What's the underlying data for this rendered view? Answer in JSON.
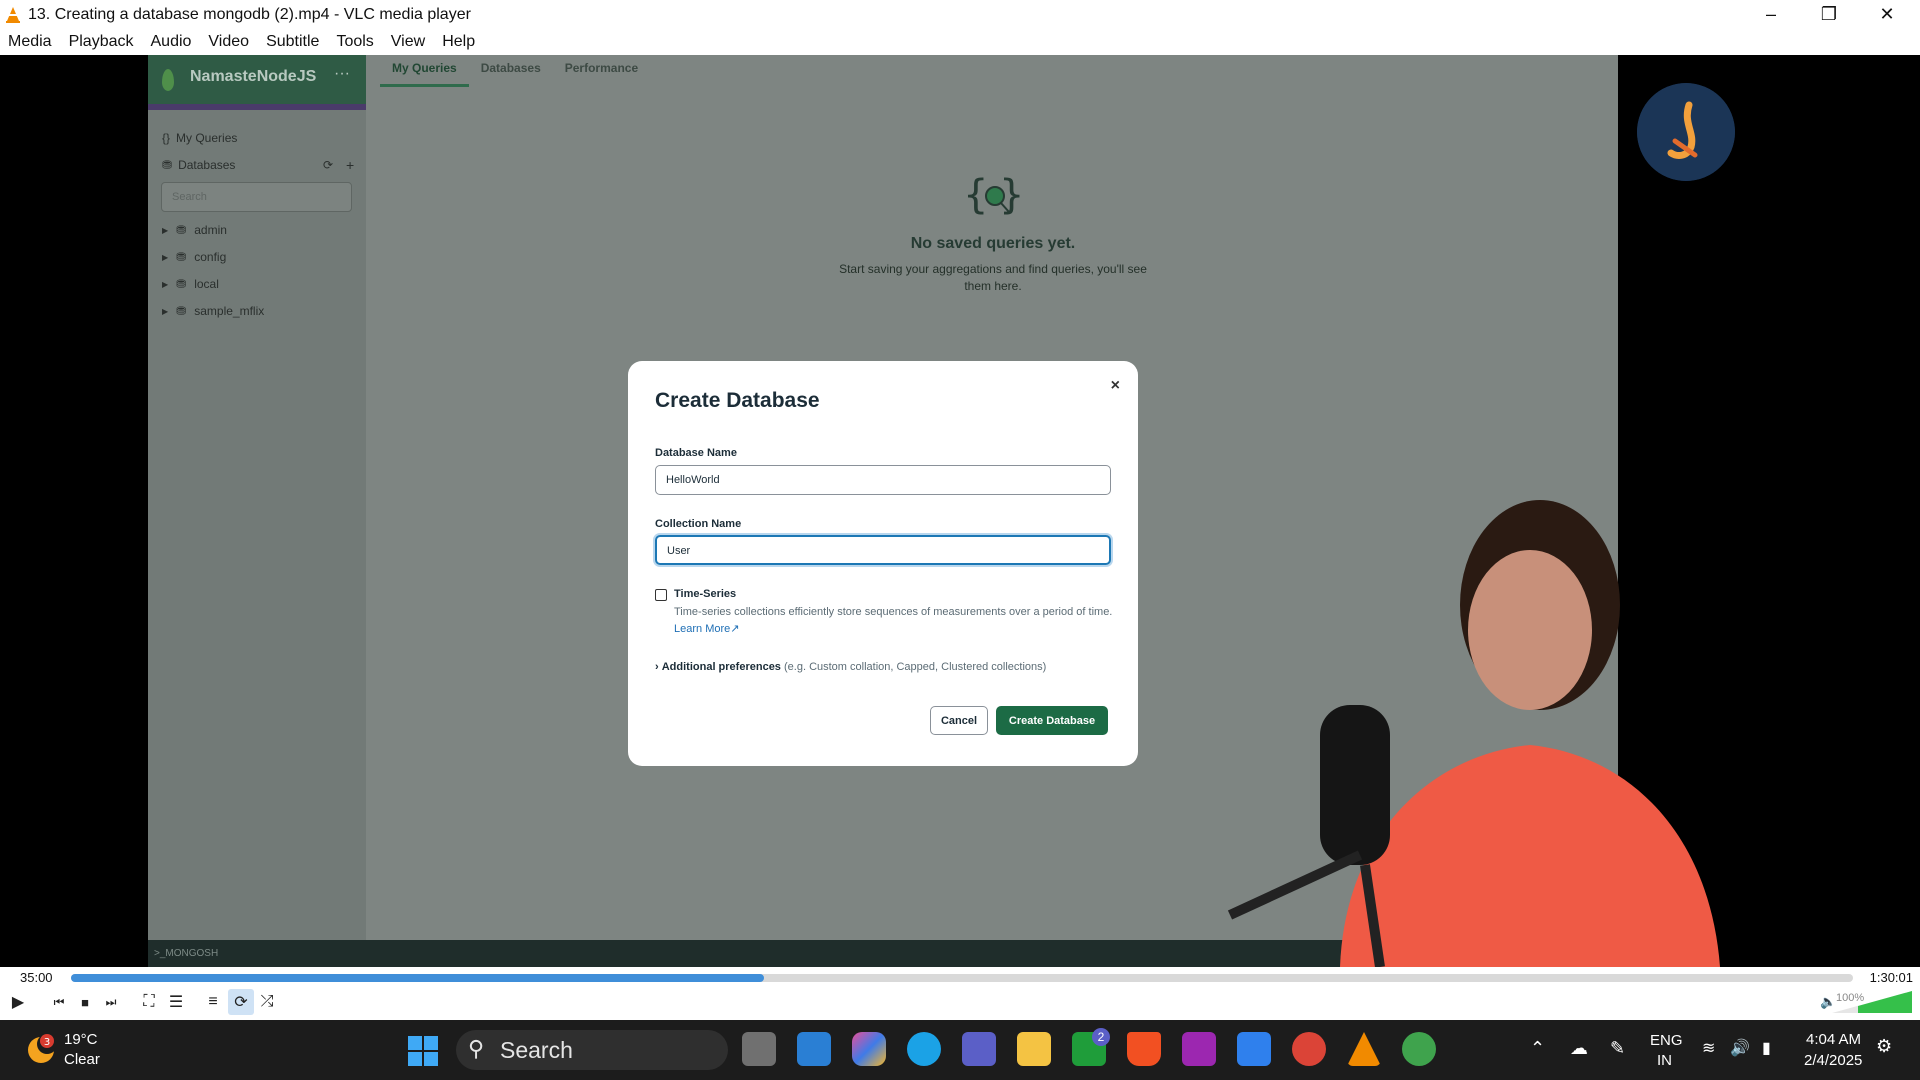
{
  "window": {
    "title": "13. Creating a database  mongodb (2).mp4 - VLC media player",
    "accent": "#f18a00"
  },
  "menu": [
    "Media",
    "Playback",
    "Audio",
    "Video",
    "Subtitle",
    "Tools",
    "View",
    "Help"
  ],
  "app": {
    "brand": "NamasteNodeJS",
    "sidebar": {
      "my_queries": "My Queries",
      "databases": "Databases",
      "search_placeholder": "Search",
      "dbs": [
        "admin",
        "config",
        "local",
        "sample_mflix"
      ]
    },
    "tabs": [
      "My Queries",
      "Databases",
      "Performance"
    ],
    "empty": {
      "title": "No saved queries yet.",
      "subtitle": "Start saving your aggregations and find queries, you'll see them here."
    },
    "footer": ">_MONGOSH"
  },
  "modal": {
    "title": "Create Database",
    "close": "×",
    "db_label": "Database Name",
    "db_value": "HelloWorld",
    "coll_label": "Collection Name",
    "coll_value": "User",
    "ts_label": "Time-Series",
    "ts_desc": "Time-series collections efficiently store sequences of measurements over a period of time.",
    "learn_more": "Learn More",
    "addpref_label": "Additional preferences",
    "addpref_hint": "(e.g. Custom collation, Capped, Clustered collections)",
    "cancel": "Cancel",
    "create": "Create Database"
  },
  "player": {
    "current_time": "35:00",
    "total_time": "1:30:01",
    "progress": 0.389,
    "volume": "100%"
  },
  "taskbar": {
    "weather_badge": "3",
    "temp": "19°C",
    "condition": "Clear",
    "search": "Search",
    "teams_badge": "2",
    "lang1": "ENG",
    "lang2": "IN",
    "time": "4:04 AM",
    "date": "2/4/2025"
  }
}
